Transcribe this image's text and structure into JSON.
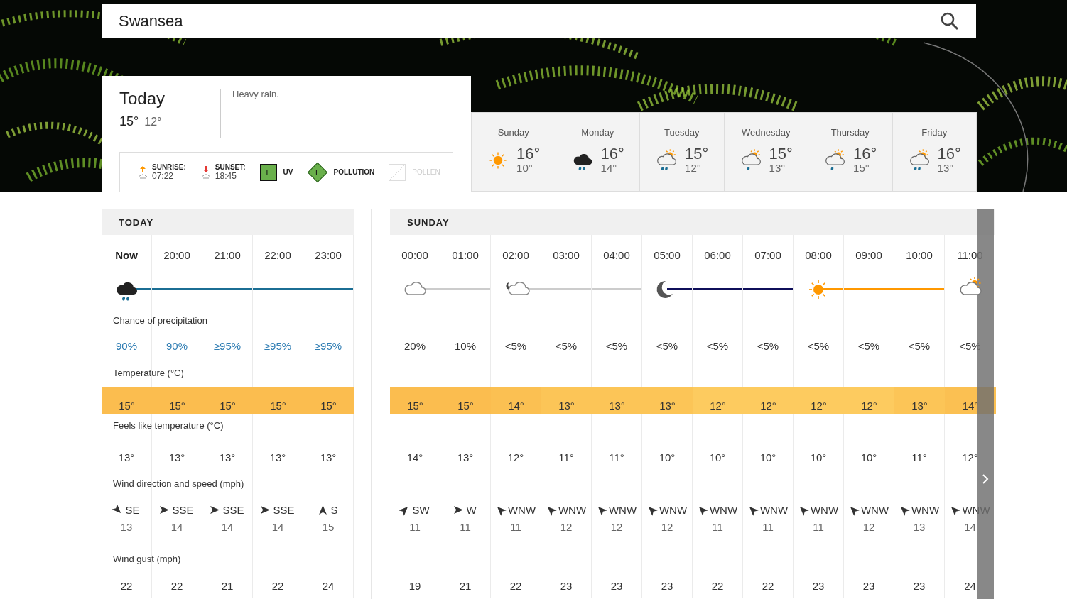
{
  "search": {
    "value": "Swansea"
  },
  "today": {
    "title": "Today",
    "high": "15°",
    "low": "12°",
    "summary": "Heavy rain.",
    "sunrise": {
      "label": "SUNRISE:",
      "time": "07:22"
    },
    "sunset": {
      "label": "SUNSET:",
      "time": "18:45"
    },
    "uv": {
      "badge": "L",
      "label": "UV"
    },
    "pollution": {
      "badge": "L",
      "label": "POLLUTION"
    },
    "pollen": {
      "label": "POLLEN",
      "disabled": true
    }
  },
  "days": [
    {
      "day": "Sunday",
      "kind": "sun",
      "high": "16°",
      "low": "10°"
    },
    {
      "day": "Monday",
      "kind": "rain",
      "high": "16°",
      "low": "14°"
    },
    {
      "day": "Tuesday",
      "kind": "showers",
      "high": "15°",
      "low": "12°"
    },
    {
      "day": "Wednesday",
      "kind": "drizzle",
      "high": "15°",
      "low": "13°"
    },
    {
      "day": "Thursday",
      "kind": "drizzle",
      "high": "16°",
      "low": "15°"
    },
    {
      "day": "Friday",
      "kind": "showers",
      "high": "16°",
      "low": "13°"
    }
  ],
  "panels": [
    {
      "heading": "TODAY",
      "row_labels": {
        "precip": "Chance of precipitation",
        "temp": "Temperature (°C)",
        "feels": "Feels like temperature (°C)",
        "wind": "Wind direction and speed (mph)",
        "gust": "Wind gust (mph)"
      },
      "hours": [
        {
          "time": "Now",
          "current": true,
          "kind": "rain",
          "line": {
            "color": "#1b6e94"
          },
          "precip": {
            "text": "90%",
            "color": "#2f7db3"
          },
          "temp": {
            "text": "15°",
            "color": "#fbbd4f"
          },
          "feels": "13°",
          "wind": {
            "kind": "downright",
            "direction": "SE",
            "speed": "13"
          },
          "gust": "22"
        },
        {
          "time": "20:00",
          "current": false,
          "kind": "plain",
          "line": {
            "color": "#1b6e94"
          },
          "precip": {
            "text": "90%",
            "color": "#2f7db3"
          },
          "temp": {
            "text": "15°",
            "color": "#fbbd4f"
          },
          "feels": "13°",
          "wind": {
            "kind": "right",
            "direction": "SSE",
            "speed": "14"
          },
          "gust": "22"
        },
        {
          "time": "21:00",
          "current": false,
          "kind": "plain",
          "line": {
            "color": "#1b6e94"
          },
          "precip": {
            "text": "≥95%",
            "color": "#2f7db3"
          },
          "temp": {
            "text": "15°",
            "color": "#fbbd4f"
          },
          "feels": "13°",
          "wind": {
            "kind": "right",
            "direction": "SSE",
            "speed": "14"
          },
          "gust": "21"
        },
        {
          "time": "22:00",
          "current": false,
          "kind": "plain",
          "line": {
            "color": "#1b6e94"
          },
          "precip": {
            "text": "≥95%",
            "color": "#2f7db3"
          },
          "temp": {
            "text": "15°",
            "color": "#fbbd4f"
          },
          "feels": "13°",
          "wind": {
            "kind": "right",
            "direction": "SSE",
            "speed": "14"
          },
          "gust": "22"
        },
        {
          "time": "23:00",
          "current": false,
          "kind": "plain",
          "line": {
            "color": "#1b6e94"
          },
          "precip": {
            "text": "≥95%",
            "color": "#2f7db3"
          },
          "temp": {
            "text": "15°",
            "color": "#fbbd4f"
          },
          "feels": "13°",
          "wind": {
            "kind": "up",
            "direction": "S",
            "speed": "15"
          },
          "gust": "24"
        }
      ]
    },
    {
      "heading": "SUNDAY",
      "hours": [
        {
          "time": "00:00",
          "current": false,
          "kind": "cloud",
          "line": {
            "color": "#cccccc"
          },
          "precip": {
            "text": "20%",
            "color": "#333333"
          },
          "temp": {
            "text": "15°",
            "color": "#fbbd4f"
          },
          "feels": "14°",
          "wind": {
            "kind": "upright",
            "direction": "SW",
            "speed": "11"
          },
          "gust": "19"
        },
        {
          "time": "01:00",
          "current": false,
          "kind": "plain",
          "line": {
            "color": "#cccccc"
          },
          "precip": {
            "text": "10%",
            "color": "#333333"
          },
          "temp": {
            "text": "15°",
            "color": "#fbbd4f"
          },
          "feels": "13°",
          "wind": {
            "kind": "right",
            "direction": "W",
            "speed": "11"
          },
          "gust": "21"
        },
        {
          "time": "02:00",
          "current": false,
          "kind": "nightcloud",
          "line": {
            "color": "#cccccc"
          },
          "precip": {
            "text": "<5%",
            "color": "#333333"
          },
          "temp": {
            "text": "14°",
            "color": "#fbc052"
          },
          "feels": "12°",
          "wind": {
            "kind": "upleft",
            "direction": "WNW",
            "speed": "11"
          },
          "gust": "22"
        },
        {
          "time": "03:00",
          "current": false,
          "kind": "plain",
          "line": {
            "color": "#cccccc"
          },
          "precip": {
            "text": "<5%",
            "color": "#333333"
          },
          "temp": {
            "text": "13°",
            "color": "#fcc557"
          },
          "feels": "11°",
          "wind": {
            "kind": "upleft",
            "direction": "WNW",
            "speed": "12"
          },
          "gust": "23"
        },
        {
          "time": "04:00",
          "current": false,
          "kind": "plain",
          "line": {
            "color": "#cccccc"
          },
          "precip": {
            "text": "<5%",
            "color": "#333333"
          },
          "temp": {
            "text": "13°",
            "color": "#fcc557"
          },
          "feels": "11°",
          "wind": {
            "kind": "upleft",
            "direction": "WNW",
            "speed": "12"
          },
          "gust": "23"
        },
        {
          "time": "05:00",
          "current": false,
          "kind": "moon",
          "line": {
            "color": "#0f0f5a"
          },
          "precip": {
            "text": "<5%",
            "color": "#333333"
          },
          "temp": {
            "text": "13°",
            "color": "#fcc557"
          },
          "feels": "10°",
          "wind": {
            "kind": "upleft",
            "direction": "WNW",
            "speed": "12"
          },
          "gust": "23"
        },
        {
          "time": "06:00",
          "current": false,
          "kind": "plain",
          "line": {
            "color": "#0f0f5a"
          },
          "precip": {
            "text": "<5%",
            "color": "#333333"
          },
          "temp": {
            "text": "12°",
            "color": "#fdcb5f"
          },
          "feels": "10°",
          "wind": {
            "kind": "upleft",
            "direction": "WNW",
            "speed": "11"
          },
          "gust": "22"
        },
        {
          "time": "07:00",
          "current": false,
          "kind": "plain",
          "line": {
            "color": "#0f0f5a"
          },
          "precip": {
            "text": "<5%",
            "color": "#333333"
          },
          "temp": {
            "text": "12°",
            "color": "#fdcb5f"
          },
          "feels": "10°",
          "wind": {
            "kind": "upleft",
            "direction": "WNW",
            "speed": "11"
          },
          "gust": "22"
        },
        {
          "time": "08:00",
          "current": false,
          "kind": "sun",
          "line": {
            "color": "#ff9800"
          },
          "precip": {
            "text": "<5%",
            "color": "#333333"
          },
          "temp": {
            "text": "12°",
            "color": "#fdcb5f"
          },
          "feels": "10°",
          "wind": {
            "kind": "upleft",
            "direction": "WNW",
            "speed": "11"
          },
          "gust": "23"
        },
        {
          "time": "09:00",
          "current": false,
          "kind": "plain",
          "line": {
            "color": "#ff9800"
          },
          "precip": {
            "text": "<5%",
            "color": "#333333"
          },
          "temp": {
            "text": "12°",
            "color": "#fdcb5f"
          },
          "feels": "10°",
          "wind": {
            "kind": "upleft",
            "direction": "WNW",
            "speed": "12"
          },
          "gust": "23"
        },
        {
          "time": "10:00",
          "current": false,
          "kind": "plain",
          "line": {
            "color": "#ff9800"
          },
          "precip": {
            "text": "<5%",
            "color": "#333333"
          },
          "temp": {
            "text": "13°",
            "color": "#fcc557"
          },
          "feels": "11°",
          "wind": {
            "kind": "upleft",
            "direction": "WNW",
            "speed": "13"
          },
          "gust": "23"
        },
        {
          "time": "11:00",
          "current": false,
          "kind": "suncloud",
          "precip": {
            "text": "<5%",
            "color": "#333333"
          },
          "temp": {
            "text": "14°",
            "color": "#fbc052"
          },
          "feels": "12°",
          "wind": {
            "kind": "upleft",
            "direction": "WNW",
            "speed": "14"
          },
          "gust": "24"
        }
      ]
    }
  ]
}
